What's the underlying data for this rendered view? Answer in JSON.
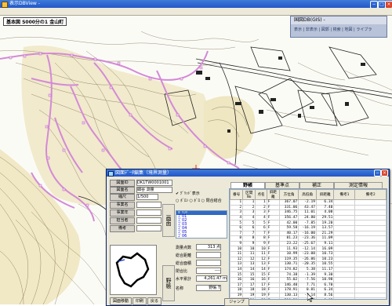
{
  "main_window": {
    "title": "表示DBView -"
  },
  "map": {
    "label": "基本図 S000分の1 金山町"
  },
  "layer_panel": {
    "header": "国図DB(GIS) -",
    "items": "表示 | 非表示 | 図郭 | 検索 | 地図 | ライブラ"
  },
  "dialog": {
    "title": "図面ﾃﾞｰﾀ編集（境界測量）",
    "fields": [
      {
        "label": "図面ID",
        "value": "DK1TW0001001"
      },
      {
        "label": "図面名",
        "value": "細谷 測量"
      },
      {
        "label": "縮尺",
        "value": "1/500"
      },
      {
        "label": "事業名",
        "value": ""
      },
      {
        "label": "事業年",
        "value": ""
      },
      {
        "label": "担当者",
        "value": ""
      },
      {
        "label": "備考",
        "value": ""
      }
    ],
    "option_label": "✔ ｸﾞﾘｯﾄﾞ表示",
    "radio_labels": [
      "ﾎﾞﾛﾝ",
      "ﾎﾞﾛ",
      "閉合結合"
    ],
    "side_tabs": [
      "画面",
      "野帳"
    ],
    "point_list": [
      "ﾎﾟｲﾝﾄ",
      "ｺﾞ01",
      "ｺﾞ02",
      "ｺﾞ03",
      "ｺﾞ04",
      "ｺﾞ05",
      "ｺﾞ06"
    ],
    "info": [
      {
        "label": "測量点数",
        "value": "313 点"
      },
      {
        "label": "総合距離",
        "value": ""
      },
      {
        "label": "総合面積",
        "value": ""
      },
      {
        "label": "閉合比",
        "value": "----"
      },
      {
        "label": "水平累計",
        "value": "4,261.47 m"
      },
      {
        "label": "名称",
        "value": "野帳 T"
      }
    ],
    "buttons": {
      "move": "図面移動",
      "print": "印刷",
      "back": "戻る",
      "jump": "ジャンプ"
    },
    "grid_tabs": [
      "野帳",
      "基準点",
      "補正",
      "測定情報"
    ],
    "table_headers": [
      "番号",
      "区間No",
      "点名",
      "斜距離",
      "方位角",
      "高低角",
      "斜距離",
      "備考1",
      "備考2"
    ],
    "table_rows": [
      [
        "1",
        "1",
        "1",
        "F",
        "367.07",
        "-2.19",
        "6.34"
      ],
      [
        "2",
        "2",
        "2",
        "F",
        "331.06",
        "43.47",
        "7.40"
      ],
      [
        "3",
        "3",
        "3",
        "F",
        "346.75",
        "11.01",
        "4.08"
      ],
      [
        "4",
        "4",
        "4",
        "F",
        "356.47",
        "24.80",
        "29.51"
      ],
      [
        "5",
        "5",
        "5",
        "F",
        "42.00",
        "-7.85",
        "19.20"
      ],
      [
        "6",
        "6",
        "6",
        "F",
        "59.58",
        "-16.19",
        "13.57"
      ],
      [
        "7",
        "7",
        "7",
        "F",
        "40.17",
        "-16.00",
        "21.29"
      ],
      [
        "8",
        "8",
        "8",
        "F",
        "81.23",
        "-23.36",
        "11.09"
      ],
      [
        "9",
        "9",
        "9",
        "F",
        "23.22",
        "-25.67",
        "9.11"
      ],
      [
        "10",
        "10",
        "10",
        "F",
        "11.93",
        "-12.14",
        "16.09"
      ],
      [
        "11",
        "11",
        "11",
        "F",
        "10.99",
        "-23.08",
        "10.73"
      ],
      [
        "12",
        "12",
        "12",
        "F",
        "119.35",
        "-26.06",
        "10.23"
      ],
      [
        "13",
        "13",
        "13",
        "F",
        "130.71",
        "-20.35",
        "10.55"
      ],
      [
        "14",
        "14",
        "14",
        "F",
        "174.82",
        "5.38",
        "11.17"
      ],
      [
        "15",
        "15",
        "15",
        "F",
        "74.38",
        "-1.39",
        "9.30"
      ],
      [
        "16",
        "16",
        "16",
        "F",
        "55.02",
        "-7.56",
        "10.98"
      ],
      [
        "17",
        "17",
        "17",
        "F",
        "146.40",
        "7.71",
        "6.70"
      ],
      [
        "18",
        "18",
        "18",
        "F",
        "178.91",
        "0.81",
        "6.34"
      ],
      [
        "19",
        "19",
        "19",
        "F",
        "130.13",
        "-7.14",
        "8.56"
      ],
      [
        "20",
        "20",
        "20",
        "F",
        "210.30",
        "-1.32",
        "8.03"
      ]
    ]
  },
  "colors": {
    "titlebar": "#2456c8",
    "boundary": "#d48ad6",
    "dialog_bg": "#ece9d8"
  }
}
